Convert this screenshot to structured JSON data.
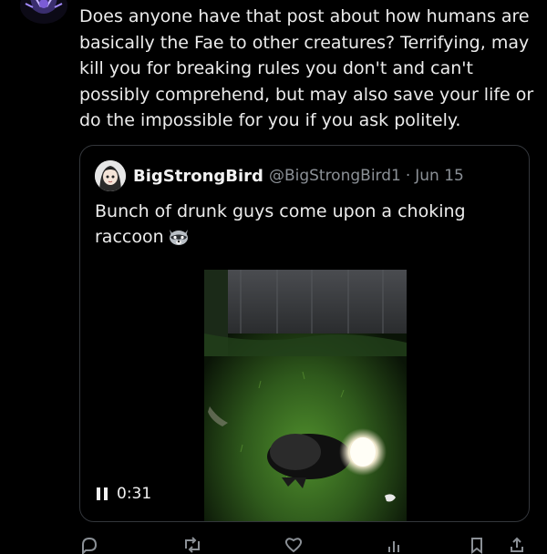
{
  "post": {
    "avatar_icon": "purple-graphic-avatar",
    "text": "Does anyone have that post about how humans are basically the Fae to other creatures? Terrifying, may kill you for breaking rules you don't and can't possibly comprehend, but may also save your life or do the impossible for you if you ask politely."
  },
  "quoted": {
    "avatar_icon": "anime-character-avatar",
    "display_name": "BigStrongBird",
    "handle": "@BigStrongBird1",
    "separator": "·",
    "date": "Jun 15",
    "text": "Bunch of drunk guys come upon a choking raccoon",
    "emoji_icon": "raccoon-emoji",
    "video": {
      "thumbnail": "night video of a raccoon on grass lit by flashlight near a wooden fence",
      "status_icon": "pause-icon",
      "time": "0:31"
    }
  },
  "actions": [
    "reply-icon",
    "retweet-icon",
    "like-icon",
    "views-icon",
    "bookmark-icon",
    "share-icon"
  ],
  "colors": {
    "background": "#000000",
    "text": "#e7e9ea",
    "muted": "#8b9096",
    "border": "#33363b"
  }
}
